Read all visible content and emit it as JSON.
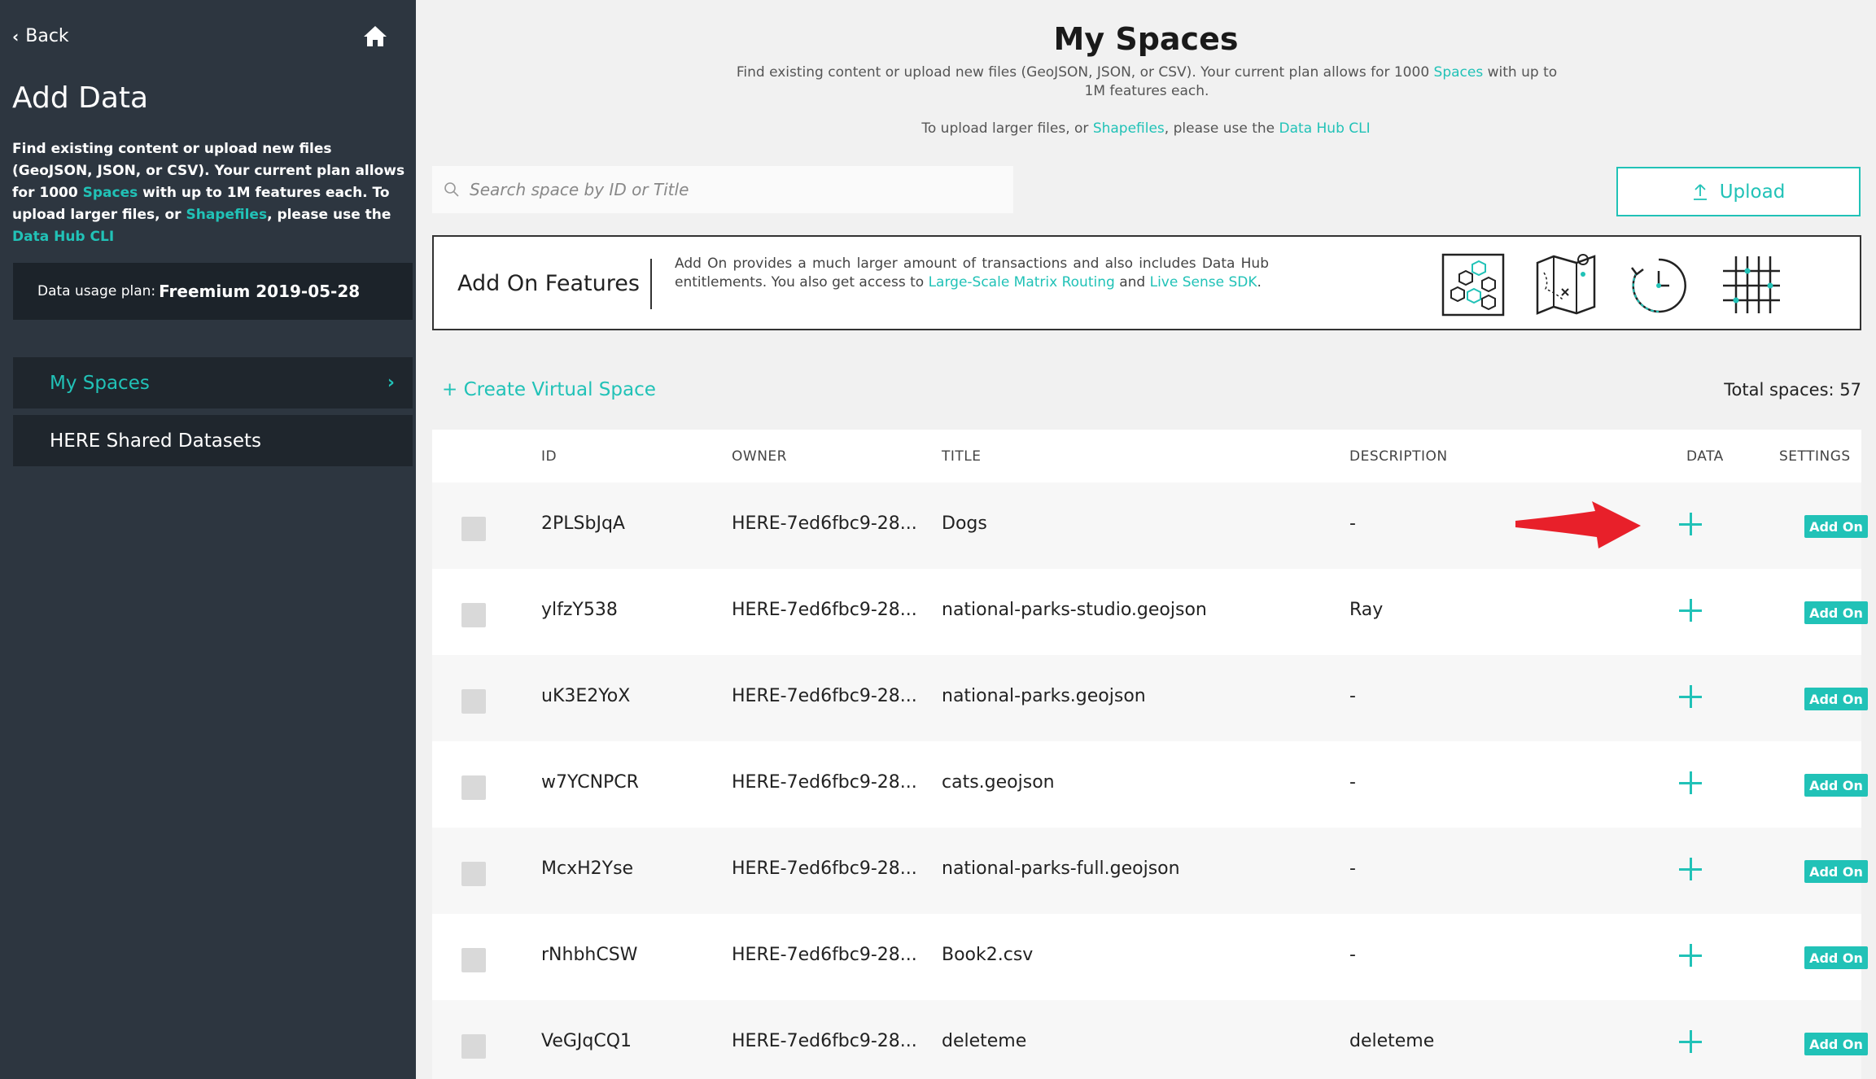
{
  "sidebar": {
    "back_label": "Back",
    "title": "Add Data",
    "desc": {
      "p1": "Find existing content or upload new files (GeoJSON, JSON, or CSV). Your current plan allows for 1000 ",
      "spaces_link": "Spaces",
      "p2": " with up to 1M features each. To upload larger files, or ",
      "shapefiles_link": "Shapefiles",
      "p3": ", please use the ",
      "cli_link": "Data Hub CLI"
    },
    "plan_label": "Data usage plan:",
    "plan_value": "Freemium 2019-05-28",
    "nav": [
      {
        "label": "My Spaces"
      },
      {
        "label": "HERE Shared Datasets"
      }
    ]
  },
  "main": {
    "title": "My Spaces",
    "intro": {
      "p1": "Find existing content or upload new files (GeoJSON, JSON, or CSV). Your current plan allows for 1000 ",
      "spaces_link": "Spaces",
      "p2": " with up to 1M features each."
    },
    "intro2": {
      "p1": "To upload larger files, or ",
      "shapefiles_link": "Shapefiles",
      "p2": ", please use the ",
      "cli_link": "Data Hub CLI"
    },
    "search_placeholder": "Search space by ID or Title",
    "upload_label": "Upload",
    "addon": {
      "title": "Add On Features",
      "text1": "Add On provides a much larger amount of transactions and also includes Data Hub entitlements. You also get access to ",
      "link1": "Large-Scale Matrix Routing",
      "text2": " and ",
      "link2": "Live Sense SDK",
      "text3": "."
    },
    "create_virtual_space": "Create Virtual Space",
    "create_plus": "+",
    "total_spaces": "Total spaces: 57",
    "table": {
      "headers": {
        "id": "ID",
        "owner": "OWNER",
        "title": "TITLE",
        "description": "DESCRIPTION",
        "data": "DATA",
        "settings": "SETTINGS"
      },
      "addon_label": "Add On",
      "rows": [
        {
          "id": "2PLSbJqA",
          "owner": "HERE-7ed6fbc9-28...",
          "title": "Dogs",
          "description": "-"
        },
        {
          "id": "ylfzY538",
          "owner": "HERE-7ed6fbc9-28...",
          "title": "national-parks-studio.geojson",
          "description": "Ray"
        },
        {
          "id": "uK3E2YoX",
          "owner": "HERE-7ed6fbc9-28...",
          "title": "national-parks.geojson",
          "description": "-"
        },
        {
          "id": "w7YCNPCR",
          "owner": "HERE-7ed6fbc9-28...",
          "title": "cats.geojson",
          "description": "-"
        },
        {
          "id": "McxH2Yse",
          "owner": "HERE-7ed6fbc9-28...",
          "title": "national-parks-full.geojson",
          "description": "-"
        },
        {
          "id": "rNhbhCSW",
          "owner": "HERE-7ed6fbc9-28...",
          "title": "Book2.csv",
          "description": "-"
        },
        {
          "id": "VeGJqCQ1",
          "owner": "HERE-7ed6fbc9-28...",
          "title": "deleteme",
          "description": "deleteme"
        }
      ]
    }
  },
  "colors": {
    "accent": "#21c2b7",
    "sidebar_bg": "#2d3640",
    "arrow": "#e8202a"
  }
}
